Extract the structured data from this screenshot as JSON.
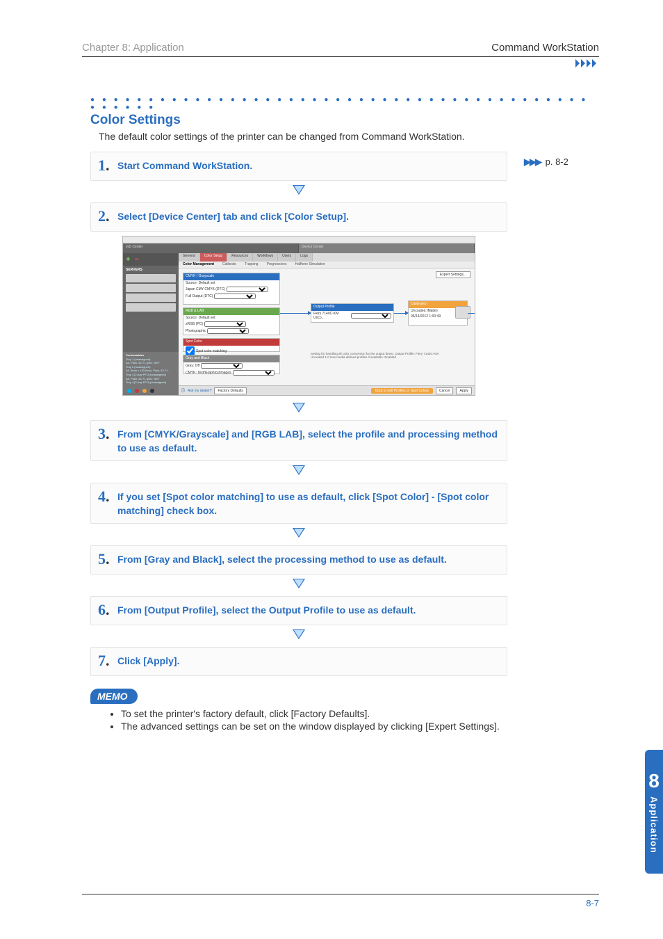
{
  "header": {
    "left": "Chapter 8: Application",
    "right": "Command WorkStation"
  },
  "section": {
    "title": "Color Settings",
    "intro": "The default color settings of the printer can be changed from Command WorkStation."
  },
  "steps": [
    {
      "num": "1",
      "text": "Start Command WorkStation.",
      "ref": "p. 8-2"
    },
    {
      "num": "2",
      "text": "Select [Device Center] tab and click [Color Setup]."
    },
    {
      "num": "3",
      "text": "From [CMYK/Grayscale] and [RGB LAB], select the profile and processing method to use as default."
    },
    {
      "num": "4",
      "text": "If you set [Spot color matching] to use as default, click [Spot Color] - [Spot color matching] check box."
    },
    {
      "num": "5",
      "text": "From [Gray and Black], select the processing method to use as default."
    },
    {
      "num": "6",
      "text": "From [Output Profile], select the Output Profile to use as default."
    },
    {
      "num": "7",
      "text": "Click [Apply]."
    }
  ],
  "memo": {
    "label": "MEMO",
    "items": [
      "To set the printer's factory default, click [Factory Defaults].",
      "The advanced settings can be set on the window displayed by clicking [Expert Settings]."
    ]
  },
  "sidetab": {
    "chapter_number": "8",
    "chapter_label": "Application"
  },
  "page_number": "8-7",
  "screenshot": {
    "top_tabs": {
      "job_center": "Job Center",
      "device_center": "Device Center"
    },
    "sub_tabs": [
      "General",
      "Color Setup",
      "Resources",
      "Workflows",
      "Users",
      "Logs"
    ],
    "row_tabs": [
      "Color Management",
      "Calibrate",
      "Trapping",
      "Progressives",
      "Halftone Simulation"
    ],
    "expert_button": "Expert Settings...",
    "left": {
      "servers_label": "SERVERS",
      "consumables_label": "Consumables",
      "tray_lines": [
        "Tray 1 (unassigned)",
        "A3, Plain, 52-71 g/m2, SEF",
        "Tray 2 (unassigned)",
        "A4, 8mm x 120.0mm, Plain, 52-71...",
        "Tray 3 [2-tray PFU] (unassigned)",
        "A3, Plain, 52-71 g/m2, SEF",
        "Tray 4 [2-tray PFU] (unassigned)",
        "A3, Plain, 52-71 g/m2, SEF",
        "Tray 5 [2-tray PFU] (unassigned)"
      ]
    },
    "panels": {
      "cmyk": {
        "title": "CMYK / Grayscale",
        "rows": [
          "Source:  Default set",
          "Japan CMY CMYK (DTC)",
          "Full Output (DTC)"
        ]
      },
      "rgb": {
        "title": "RGB  &  LAB",
        "rows": [
          "Source:  Default set",
          "sRGB (PC)",
          "Photographic"
        ]
      },
      "spot": {
        "title": "Spot Color",
        "rows": [
          "Spot color matching"
        ]
      },
      "gray": {
        "title": "Gray and Black",
        "rows": [
          "Gray:  Off",
          "CMYK:  Text/Graphics/Images"
        ]
      },
      "output": {
        "title": "Output Profile",
        "rows": [
          "Fiery 7140C-KM Unco..."
        ]
      },
      "calib": {
        "title": "Calibration",
        "rows": [
          "Uncoated (Matte)",
          "06/14/2012 1:00:49"
        ]
      }
    },
    "footer": {
      "ask_help": "Ask my dealer?",
      "factory": "Factory Defaults",
      "hint": "Click to edit Profiles or Spot Colors",
      "cancel": "Cancel",
      "apply": "Apply"
    },
    "description": "Setting for handling all color conversion for the output driver.\nOutput Profile: Fiery 7140C-KM Uncoated 1.0\nUse media defined profiles if available: Enabled"
  }
}
